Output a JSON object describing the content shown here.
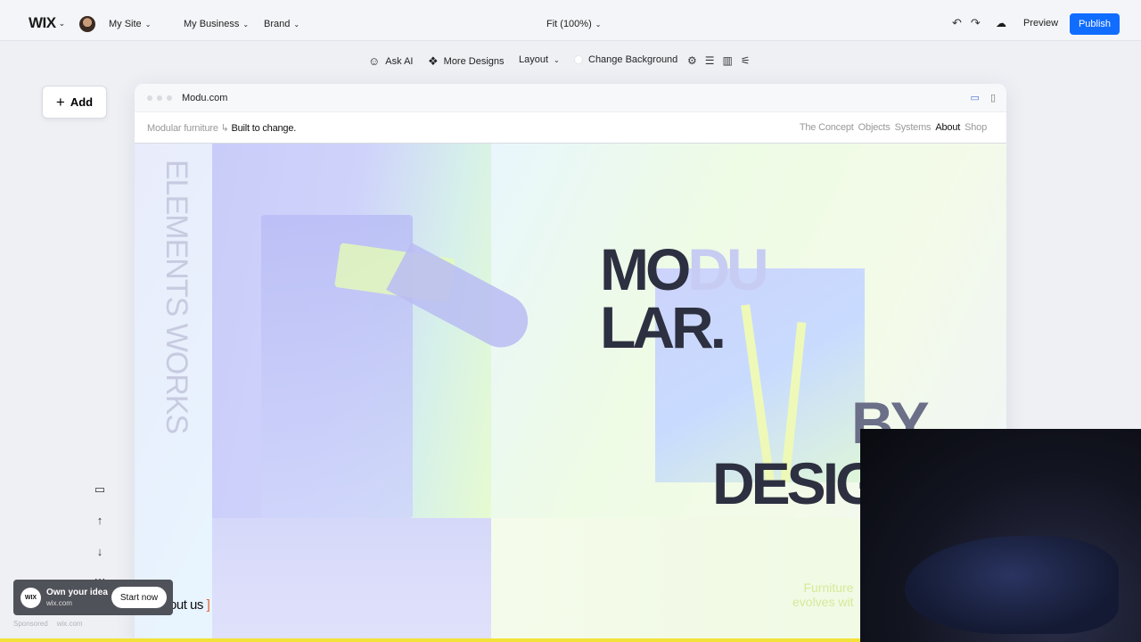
{
  "topbar": {
    "logo": "WIX",
    "site_menu": "My Site",
    "business_menu": "My Business",
    "brand_menu": "Brand",
    "zoom": "Fit (100%)",
    "preview": "Preview",
    "publish": "Publish"
  },
  "subbar": {
    "ask_ai": "Ask AI",
    "more_designs": "More Designs",
    "layout": "Layout",
    "change_background": "Change Background"
  },
  "add_button": {
    "label": "Add"
  },
  "browser": {
    "url": "Modu.com"
  },
  "site": {
    "tagline_muted": "Modular furniture ↳",
    "tagline_strong": "Built to change.",
    "nav": [
      "The Concept",
      "Objects",
      "Systems",
      "About",
      "Shop"
    ],
    "active_nav": "About",
    "vertical_text": "ELEMENTS WORKS",
    "headline_1a": "MO",
    "headline_1b": "DU",
    "headline_2": "LAR.",
    "headline_3": "BY",
    "headline_4": "DESIG",
    "about_open": "[",
    "about_label": "About us",
    "about_close": "]",
    "furniture_line1": "Furniture",
    "furniture_line2": "evolves wit"
  },
  "ad": {
    "logo": "WIX",
    "title": "Own your idea",
    "subtitle": "wix.com",
    "cta": "Start now",
    "sponsored": "Sponsored",
    "domain": "wix.com"
  }
}
